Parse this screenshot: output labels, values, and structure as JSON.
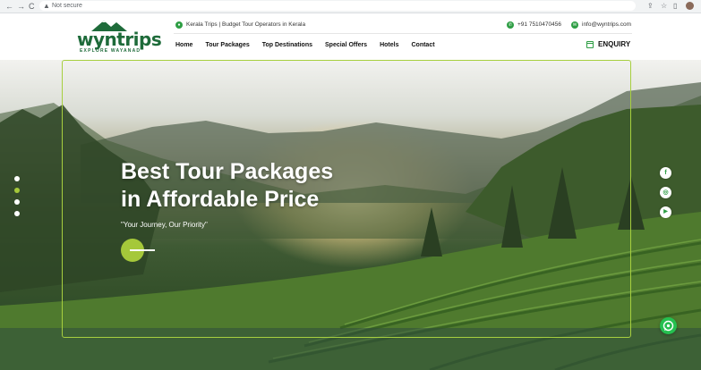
{
  "browser": {
    "back_icon": "←",
    "forward_icon": "→",
    "reload_icon": "C",
    "warning_icon": "▲",
    "security_label": "Not secure",
    "share_icon": "⇪",
    "star_icon": "☆",
    "panel_icon": "▯"
  },
  "header": {
    "logo_text": "wyntrips",
    "logo_subtitle": "EXPLORE WAYANAD",
    "tagline": "Kerala Trips | Budget Tour Operators in Kerala",
    "phone": "+91 7510470456",
    "email": "info@wyntrips.com",
    "enquiry_label": "ENQUIRY",
    "nav": [
      "Home",
      "Tour Packages",
      "Top Destinations",
      "Special Offers",
      "Hotels",
      "Contact"
    ]
  },
  "hero": {
    "headline_line1": "Best Tour Packages",
    "headline_line2": "in Affordable Price",
    "tagline": "\"Your Journey, Our Priority\"",
    "slide_count": 4,
    "active_slide": 2
  },
  "social": {
    "facebook": "f",
    "instagram": "◎",
    "youtube": "▶",
    "whatsapp": "✆"
  },
  "colors": {
    "accent_green": "#a5c83a",
    "brand_green": "#1e6b3a",
    "icon_green": "#2e9e44"
  }
}
